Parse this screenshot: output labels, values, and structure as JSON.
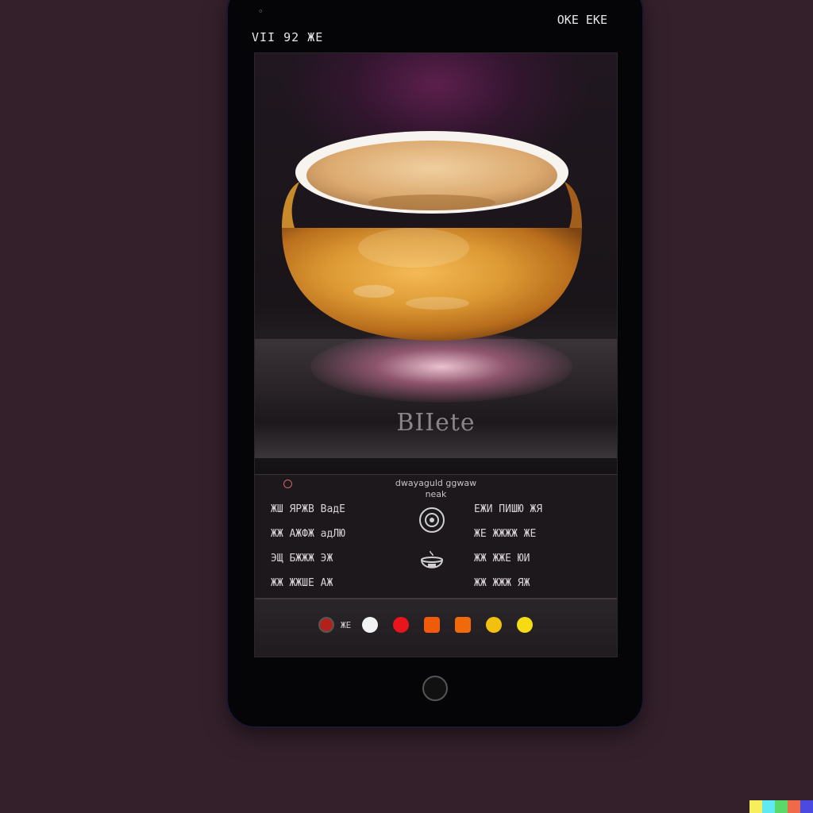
{
  "status_bar": {
    "left_text": "VII 92 ЖЕ",
    "right_text": "ОКЕ ЕКЕ"
  },
  "hero": {
    "label": "BIIete"
  },
  "info_panel": {
    "title": "dwayaguld ggwaw",
    "subtitle": "neak",
    "left_rows": [
      "ЖШ  ЯРЖВ  ВадЕ",
      "ЖЖ  АЖФЖ  адЛЮ",
      "ЭЩ  БЖЖЖ  ЭЖ",
      "ЖЖ  ЖЖШЕ  АЖ"
    ],
    "right_rows": [
      "ЕЖИ  ПИШЮ  ЖЯ",
      "ЖЕ  ЖЖЖЖ  ЖЕ",
      "ЖЖ  ЖЖЕ  ЮИ",
      "ЖЖ  ЖЖЖ  ЯЖ"
    ]
  },
  "toolbar": {
    "label": "ЖЕ",
    "swatches": [
      {
        "color": "#f2f2f2",
        "shape": "circle"
      },
      {
        "color": "#e8151d",
        "shape": "circle"
      },
      {
        "color": "#f05a0b",
        "shape": "square"
      },
      {
        "color": "#f06a0c",
        "shape": "square"
      },
      {
        "color": "#f2c10f",
        "shape": "circle"
      },
      {
        "color": "#f4db14",
        "shape": "circle"
      }
    ]
  },
  "icons": {
    "center_top": "coin-icon",
    "center_bottom": "cauldron-icon",
    "home": "home-button-icon"
  },
  "colors": {
    "background": "#34202b",
    "phone": "#050406",
    "accent": "#5c1f4d"
  }
}
